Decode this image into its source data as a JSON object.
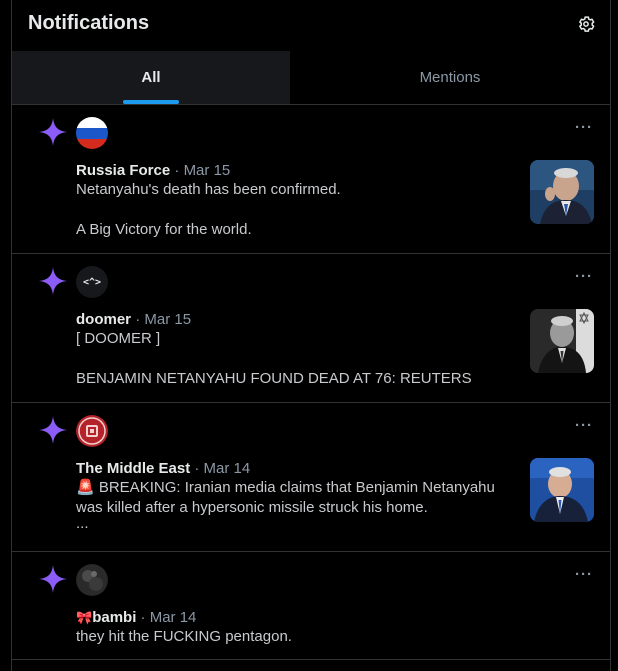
{
  "header": {
    "title": "Notifications"
  },
  "tabs": [
    {
      "label": "All",
      "active": true
    },
    {
      "label": "Mentions",
      "active": false
    }
  ],
  "colors": {
    "accent": "#1d9bf0",
    "star": "#8b5cf6",
    "background": "#000000",
    "muted": "#8b98a5"
  },
  "items": [
    {
      "name": "Russia Force",
      "separator": "·",
      "date": "Mar 15",
      "lines": [
        "Netanyahu's death has been confirmed.",
        "",
        "A Big Victory for the world."
      ],
      "avatar": "russia-flag-avatar",
      "has_thumb": true
    },
    {
      "name": "doomer",
      "separator": "·",
      "date": "Mar 15",
      "lines": [
        "[ DOOMER ]",
        "",
        "BENJAMIN NETANYAHU FOUND DEAD AT 76: REUTERS"
      ],
      "avatar": "code-brackets-avatar",
      "avatar_text": "<^>",
      "has_thumb": true
    },
    {
      "name": "The Middle East",
      "separator": "·",
      "date": "Mar 14",
      "lines": [
        "🚨 BREAKING: Iranian media claims that Benjamin Netanyahu",
        "was killed after a hypersonic missile struck his home.",
        "..."
      ],
      "avatar": "red-emblem-avatar",
      "has_thumb": true
    },
    {
      "name": "bambi",
      "name_prefix": "🎀",
      "separator": "·",
      "date": "Mar 14",
      "lines": [
        "they hit the FUCKING pentagon."
      ],
      "avatar": "dark-photo-avatar",
      "has_thumb": false
    }
  ],
  "more_label": "···"
}
